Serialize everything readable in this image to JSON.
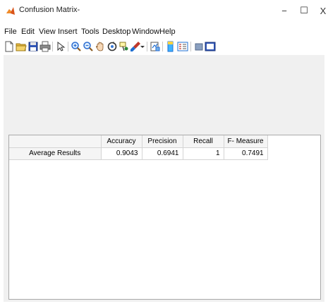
{
  "window": {
    "title": "Confusion Matrix-",
    "controls": {
      "minimize": "−",
      "maximize": "☐",
      "close": "X"
    }
  },
  "menu": {
    "items": [
      "File",
      "Edit",
      "View",
      "Insert",
      "Tools",
      "Desktop",
      "Window",
      "Help"
    ]
  },
  "toolbar": {
    "icons": [
      "new-figure-icon",
      "open-file-icon",
      "save-icon",
      "print-icon",
      "pointer-icon",
      "zoom-in-icon",
      "zoom-out-icon",
      "pan-hand-icon",
      "rotate-3d-icon",
      "data-cursor-icon",
      "brush-icon",
      "brush-dropdown-icon",
      "link-plot-icon",
      "insert-colorbar-icon",
      "insert-legend-icon",
      "hide-plot-tools-icon",
      "show-plot-tools-icon"
    ]
  },
  "table": {
    "columns": [
      "Accuracy",
      "Precision",
      "Recall",
      "F- Measure"
    ],
    "rows": [
      {
        "label": "Average Results",
        "values": [
          "0.9043",
          "0.6941",
          "1",
          "0.7491"
        ]
      }
    ]
  }
}
